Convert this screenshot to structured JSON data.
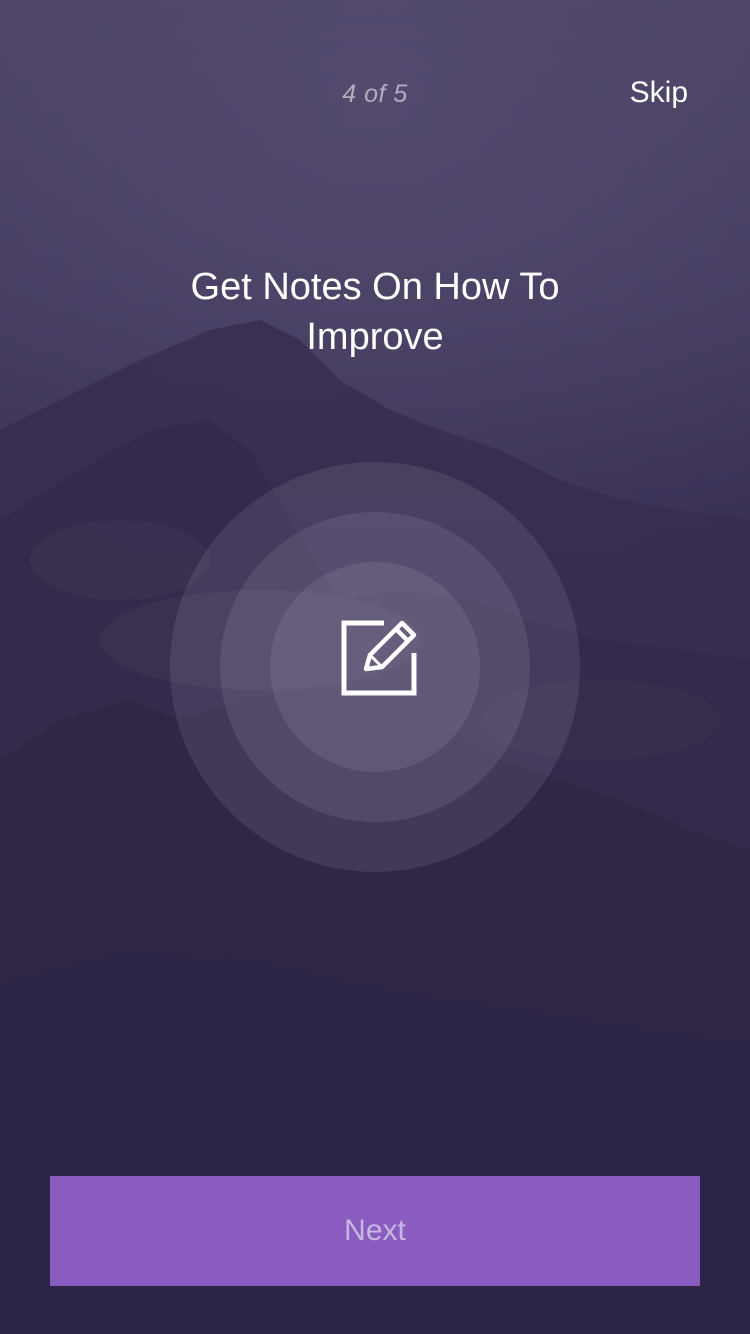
{
  "header": {
    "step_counter": "4 of 5",
    "skip_label": "Skip"
  },
  "content": {
    "title": "Get Notes On How To Improve",
    "icon": "edit-note-icon"
  },
  "footer": {
    "next_label": "Next"
  },
  "colors": {
    "accent": "#8a5cbf",
    "background": "#3a3150",
    "text": "#ffffff"
  }
}
